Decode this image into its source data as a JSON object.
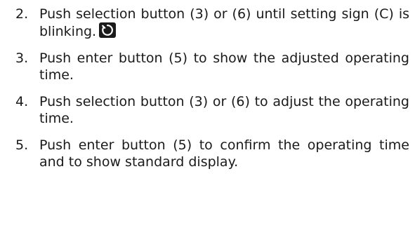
{
  "steps": [
    {
      "number": "2.",
      "text": "Push selection button (3) or (6) until setting sign (C) is blinking.",
      "icon": "timer-icon"
    },
    {
      "number": "3.",
      "text": "Push enter button (5) to show the adjusted operating time."
    },
    {
      "number": "4.",
      "text": "Push selection button (3) or (6) to adjust the operating time."
    },
    {
      "number": "5.",
      "text": "Push enter button (5) to confirm the operating time and to show standard display."
    }
  ]
}
